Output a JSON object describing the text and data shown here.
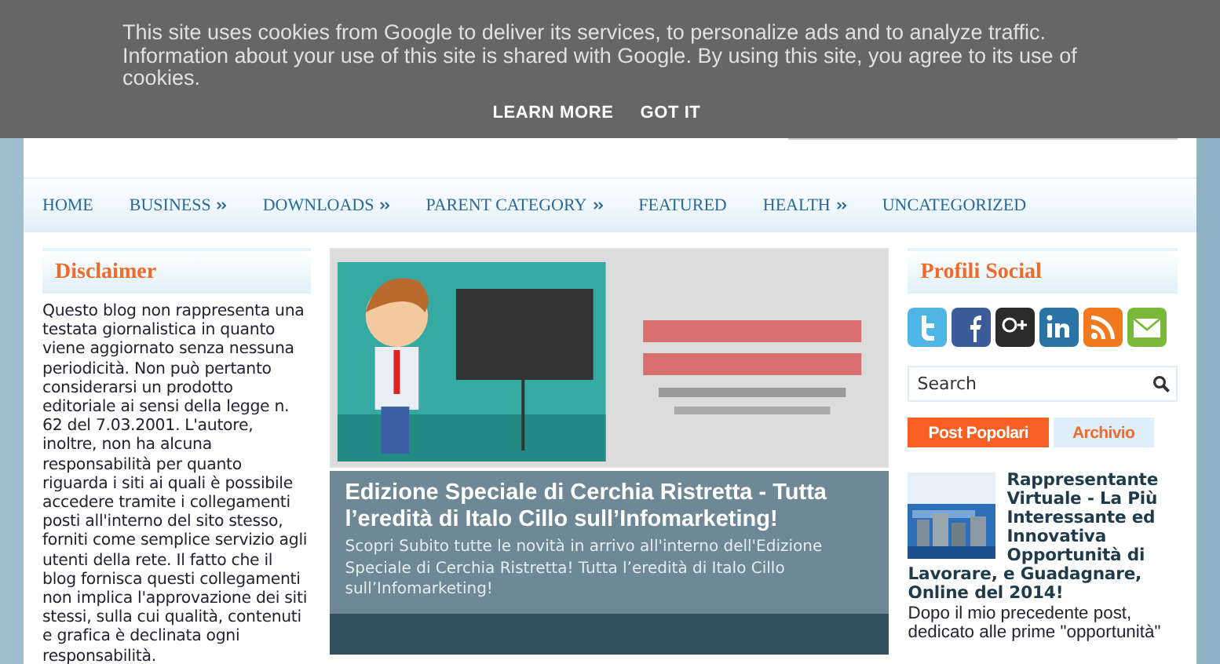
{
  "cookie_notice": {
    "text": "This site uses cookies from Google to deliver its services, to personalize ads and to analyze traffic. Information about your use of this site is shared with Google. By using this site, you agree to its use of cookies.",
    "buttons": [
      "LEARN MORE",
      "GOT IT"
    ]
  },
  "nav": [
    {
      "label": "HOME",
      "submenu": false
    },
    {
      "label": "BUSINESS",
      "submenu": true
    },
    {
      "label": "DOWNLOADS",
      "submenu": true
    },
    {
      "label": "PARENT CATEGORY",
      "submenu": true
    },
    {
      "label": "FEATURED",
      "submenu": false
    },
    {
      "label": "HEALTH",
      "submenu": true
    },
    {
      "label": "UNCATEGORIZED",
      "submenu": false
    }
  ],
  "disclaimer": {
    "title": "Disclaimer",
    "text": "Questo blog non rappresenta una testata giornalistica in quanto viene aggiornato senza nessuna periodicità. Non può pertanto considerarsi un prodotto editoriale ai sensi della legge n. 62 del 7.03.2001. L'autore, inoltre, non ha alcuna responsabilità per quanto riguarda i siti ai quali è possibile accedere tramite i collegamenti posti all'interno del sito stesso, forniti come semplice servizio agli utenti della rete. Il fatto che il blog fornisca questi collegamenti non implica l'approvazione dei siti stessi, sulla cui qualità, contenuti e grafica è declinata ogni responsabilità."
  },
  "slider": {
    "title": "Edizione Speciale di Cerchia Ristretta - Tutta l’eredità di Italo Cillo sull’Infomarketing!",
    "text": "Scopri Subito tutte le novità in arrivo all'interno dell'Edizione Speciale di Cerchia Ristretta! Tutta l’eredità di Italo Cillo sull’Infomarketing!"
  },
  "social": {
    "title": "Profili Social",
    "icons": [
      {
        "kind": "twitter"
      },
      {
        "kind": "facebook"
      },
      {
        "kind": "googleplus"
      },
      {
        "kind": "linkedin"
      },
      {
        "kind": "rss"
      },
      {
        "kind": "email"
      }
    ]
  },
  "search": {
    "placeholder": "Search"
  },
  "tabs": [
    {
      "label": "Post Popolari",
      "selected": true
    },
    {
      "label": "Archivio",
      "selected": false
    }
  ],
  "popular_post": {
    "title": "Rappresentante Virtuale - La Più Interessante ed Innovativa Opportunità di Lavorare, e Guadagnare, Online del 2014!",
    "excerpt": "Dopo il mio precedente post, dedicato alle prime \"opportunità\""
  }
}
